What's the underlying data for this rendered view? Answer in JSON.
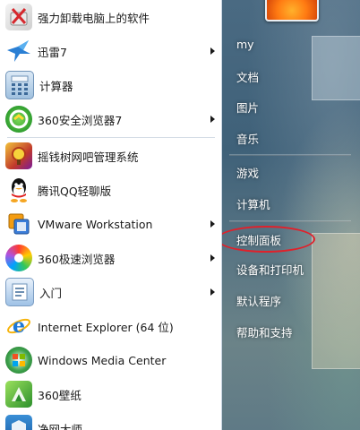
{
  "programs": [
    {
      "label": "强力卸载电脑上的软件",
      "icon": "uninstall-icon",
      "has_submenu": false
    },
    {
      "label": "迅雷7",
      "icon": "xunlei-bird-icon",
      "has_submenu": true
    },
    {
      "label": "计算器",
      "icon": "calculator-icon",
      "has_submenu": false
    },
    {
      "label": "360安全浏览器7",
      "icon": "360-browser-icon",
      "has_submenu": true
    },
    {
      "label": "摇钱树网吧管理系统",
      "icon": "money-tree-icon",
      "has_submenu": false
    },
    {
      "label": "腾讯QQ轻聊版",
      "icon": "qq-penguin-icon",
      "has_submenu": false
    },
    {
      "label": "VMware Workstation",
      "icon": "vmware-icon",
      "has_submenu": true
    },
    {
      "label": "360极速浏览器",
      "icon": "360-speed-browser-icon",
      "has_submenu": true
    },
    {
      "label": "入门",
      "icon": "getting-started-icon",
      "has_submenu": true
    },
    {
      "label": "Internet Explorer (64 位)",
      "icon": "internet-explorer-icon",
      "has_submenu": false
    },
    {
      "label": "Windows Media Center",
      "icon": "media-center-icon",
      "has_submenu": false
    },
    {
      "label": "360壁纸",
      "icon": "360-wallpaper-icon",
      "has_submenu": false
    },
    {
      "label": "净网大师",
      "icon": "jingwang-icon",
      "has_submenu": false
    }
  ],
  "places": [
    {
      "label": "my"
    },
    {
      "label": "文档"
    },
    {
      "label": "图片"
    },
    {
      "label": "音乐"
    },
    {
      "label": "游戏"
    },
    {
      "label": "计算机"
    },
    {
      "label": "控制面板"
    },
    {
      "label": "设备和打印机"
    },
    {
      "label": "默认程序"
    },
    {
      "label": "帮助和支持"
    }
  ],
  "colors": {
    "highlight_ring": "#e0212b",
    "right_pane": "#4a6a82"
  }
}
